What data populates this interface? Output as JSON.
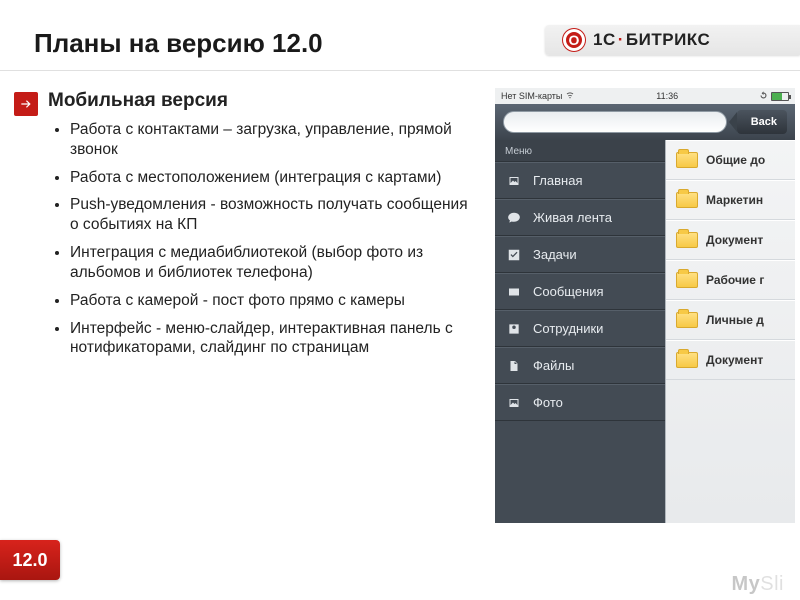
{
  "brand": {
    "name_left": "1С",
    "name_right": "БИТРИКС"
  },
  "title": "Планы на версию 12.0",
  "subtitle": "Мобильная версия",
  "bullets": [
    "Работа с контактами – загрузка, управление, прямой звонок",
    "Работа с местоположением (интеграция с картами)",
    "Push-уведомления - возможность получать сообщения о событиях на КП",
    "Интеграция с медиабиблиотекой (выбор фото из альбомов и библиотек телефона)",
    "Работа с камерой - пост фото прямо с камеры",
    "Интерфейс - меню-слайдер, интерактивная панель с нотификаторами, слайдинг по страницам"
  ],
  "version_badge": "12.0",
  "phone": {
    "status": {
      "carrier": "Нет SIM-карты",
      "time": "11:36"
    },
    "back_label": "Back",
    "menu_header": "Меню",
    "menu_items": [
      {
        "label": "Главная",
        "icon": "image-icon"
      },
      {
        "label": "Живая лента",
        "icon": "chat-icon"
      },
      {
        "label": "Задачи",
        "icon": "check-icon"
      },
      {
        "label": "Сообщения",
        "icon": "mail-icon"
      },
      {
        "label": "Сотрудники",
        "icon": "person-icon"
      },
      {
        "label": "Файлы",
        "icon": "file-icon"
      },
      {
        "label": "Фото",
        "icon": "photo-icon"
      }
    ],
    "folders": [
      "Общие до",
      "Маркетин",
      "Документ",
      "Рабочие г",
      "Личные д",
      "Документ"
    ]
  },
  "watermark": {
    "a": "My",
    "b": "Sli"
  }
}
